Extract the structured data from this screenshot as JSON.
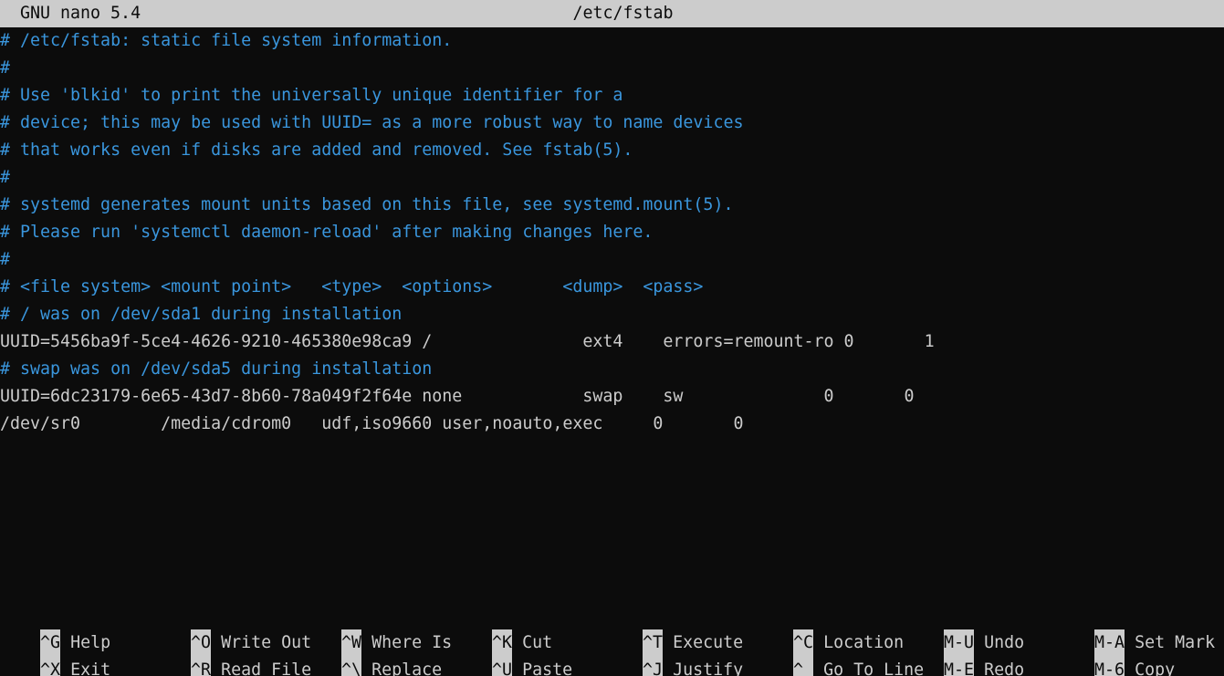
{
  "header": {
    "app_version": "GNU nano 5.4",
    "file_name": "/etc/fstab"
  },
  "editor": {
    "lines": [
      {
        "text": "# /etc/fstab: static file system information.",
        "kind": "comment"
      },
      {
        "text": "#",
        "kind": "comment"
      },
      {
        "text": "# Use 'blkid' to print the universally unique identifier for a",
        "kind": "comment"
      },
      {
        "text": "# device; this may be used with UUID= as a more robust way to name devices",
        "kind": "comment"
      },
      {
        "text": "# that works even if disks are added and removed. See fstab(5).",
        "kind": "comment"
      },
      {
        "text": "#",
        "kind": "comment"
      },
      {
        "text": "# systemd generates mount units based on this file, see systemd.mount(5).",
        "kind": "comment"
      },
      {
        "text": "# Please run 'systemctl daemon-reload' after making changes here.",
        "kind": "comment"
      },
      {
        "text": "#",
        "kind": "comment"
      },
      {
        "text": "# <file system> <mount point>   <type>  <options>       <dump>  <pass>",
        "kind": "comment"
      },
      {
        "text": "# / was on /dev/sda1 during installation",
        "kind": "comment"
      },
      {
        "text": "UUID=5456ba9f-5ce4-4626-9210-465380e98ca9 /               ext4    errors=remount-ro 0       1",
        "kind": "plain"
      },
      {
        "text": "# swap was on /dev/sda5 during installation",
        "kind": "comment"
      },
      {
        "text": "UUID=6dc23179-6e65-43d7-8b60-78a049f2f64e none            swap    sw              0       0",
        "kind": "plain"
      },
      {
        "text": "/dev/sr0        /media/cdrom0   udf,iso9660 user,noauto,exec     0       0",
        "kind": "plain"
      }
    ]
  },
  "shortcuts": {
    "row1": [
      {
        "key": "^G",
        "label": "Help"
      },
      {
        "key": "^O",
        "label": "Write Out"
      },
      {
        "key": "^W",
        "label": "Where Is"
      },
      {
        "key": "^K",
        "label": "Cut"
      },
      {
        "key": "^T",
        "label": "Execute"
      },
      {
        "key": "^C",
        "label": "Location"
      },
      {
        "key": "M-U",
        "label": "Undo"
      },
      {
        "key": "M-A",
        "label": "Set Mark"
      }
    ],
    "row2": [
      {
        "key": "^X",
        "label": "Exit"
      },
      {
        "key": "^R",
        "label": "Read File"
      },
      {
        "key": "^\\",
        "label": "Replace"
      },
      {
        "key": "^U",
        "label": "Paste"
      },
      {
        "key": "^J",
        "label": "Justify"
      },
      {
        "key": "^_",
        "label": "Go To Line"
      },
      {
        "key": "M-E",
        "label": "Redo"
      },
      {
        "key": "M-6",
        "label": "Copy"
      }
    ]
  },
  "colors": {
    "background": "#0c0c0c",
    "foreground": "#cccccc",
    "comment": "#3a96dd",
    "titlebar_bg": "#cccccc",
    "titlebar_fg": "#0c0c0c"
  }
}
